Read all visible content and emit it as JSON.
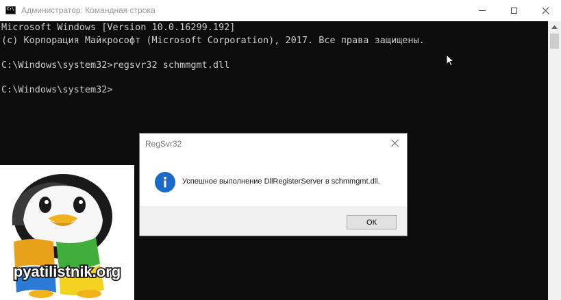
{
  "window": {
    "title": "Администратор: Командная строка",
    "icon": "cmd-app-icon",
    "icon_text": "C:\\",
    "controls": [
      "minimize-icon",
      "maximize-icon",
      "close-icon"
    ]
  },
  "console": {
    "lines": [
      "Microsoft Windows [Version 10.0.16299.192]",
      "(c) Корпорация Майкрософт (Microsoft Corporation), 2017. Все права защищены.",
      "C:\\Windows\\system32>regsvr32 schmmgmt.dll",
      "C:\\Windows\\system32>"
    ],
    "text_color": "#cccccc",
    "background": "#0c0c0c"
  },
  "dialog": {
    "title": "RegSvr32",
    "icon": "info-icon",
    "message": "Успешное выполнение DllRegisterServer в schmmgmt.dll.",
    "ok_label": "ОК",
    "accent": "#1b6ac9"
  },
  "watermark": {
    "text": "pyatilistnik.org",
    "icon": "penguin-windows-logo"
  }
}
